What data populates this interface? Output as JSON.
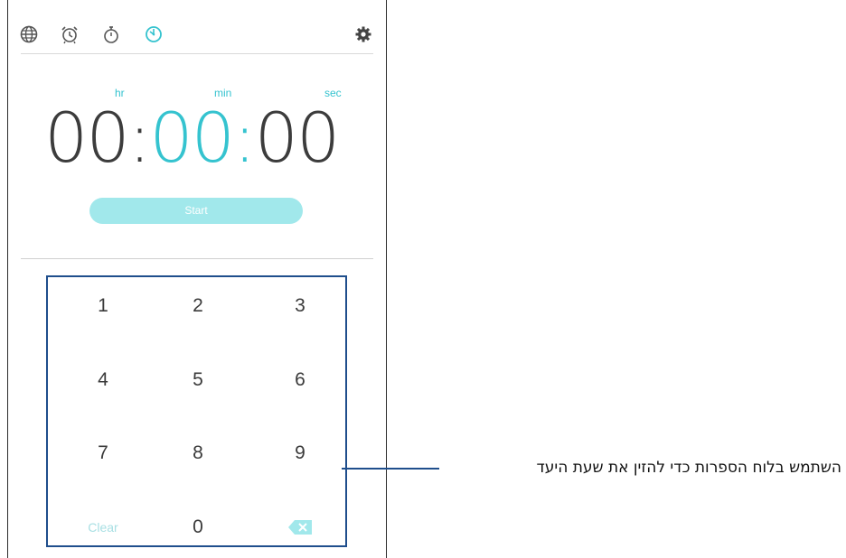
{
  "tabs": [
    {
      "id": "world-clock",
      "icon": "globe-icon",
      "active": false
    },
    {
      "id": "alarm",
      "icon": "alarm-clock-icon",
      "active": false
    },
    {
      "id": "stopwatch",
      "icon": "stopwatch-icon",
      "active": false
    },
    {
      "id": "timer",
      "icon": "timer-icon",
      "active": true
    }
  ],
  "settings_icon": "gear-icon",
  "timer": {
    "unit_labels": {
      "hr": "hr",
      "min": "min",
      "sec": "sec"
    },
    "hours": "00",
    "minutes": "00",
    "seconds": "00",
    "separator": ":"
  },
  "start_label": "Start",
  "keypad": {
    "keys": [
      "1",
      "2",
      "3",
      "4",
      "5",
      "6",
      "7",
      "8",
      "9"
    ],
    "clear_label": "Clear",
    "zero": "0",
    "backspace_icon": "backspace-icon"
  },
  "callout": "השתמש בלוח הספרות כדי להזין את שעת היעד",
  "colors": {
    "accent": "#35c3cf",
    "start_button": "#a1e8eb",
    "callout_frame": "#1f4e8c",
    "digits": "#3c3c3c"
  }
}
